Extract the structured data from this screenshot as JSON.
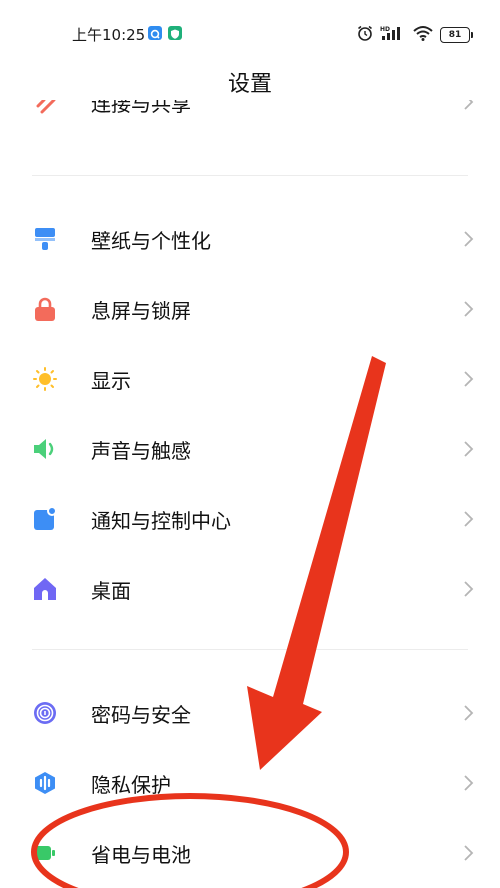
{
  "status_bar": {
    "time": "上午10:25",
    "battery": "81",
    "icons": [
      "alarm-icon",
      "hd-signal-icon",
      "wifi-icon",
      "battery-icon"
    ],
    "notification_icons": [
      "app-notification-icon",
      "shield-notification-icon"
    ]
  },
  "header": {
    "title": "设置"
  },
  "clipped_item": {
    "label": "连接与共享",
    "icon": "share-icon"
  },
  "groups": [
    {
      "items": [
        {
          "label": "壁纸与个性化",
          "icon": "brush-icon",
          "color": "#3d8ef5"
        },
        {
          "label": "息屏与锁屏",
          "icon": "lock-icon",
          "color": "#f36b5b"
        },
        {
          "label": "显示",
          "icon": "sun-icon",
          "color": "#ffbf2a"
        },
        {
          "label": "声音与触感",
          "icon": "speaker-icon",
          "color": "#4bd07a"
        },
        {
          "label": "通知与控制中心",
          "icon": "notification-icon",
          "color": "#3d8ef5"
        },
        {
          "label": "桌面",
          "icon": "home-icon",
          "color": "#7067f4"
        }
      ]
    },
    {
      "items": [
        {
          "label": "密码与安全",
          "icon": "fingerprint-icon",
          "color": "#6b6cf3"
        },
        {
          "label": "隐私保护",
          "icon": "privacy-shield-icon",
          "color": "#3d8ef5"
        },
        {
          "label": "省电与电池",
          "icon": "battery-saver-icon",
          "color": "#39c968"
        }
      ]
    }
  ],
  "annotation": {
    "color": "#e8341c",
    "shapes": [
      "arrow",
      "ellipse"
    ]
  }
}
